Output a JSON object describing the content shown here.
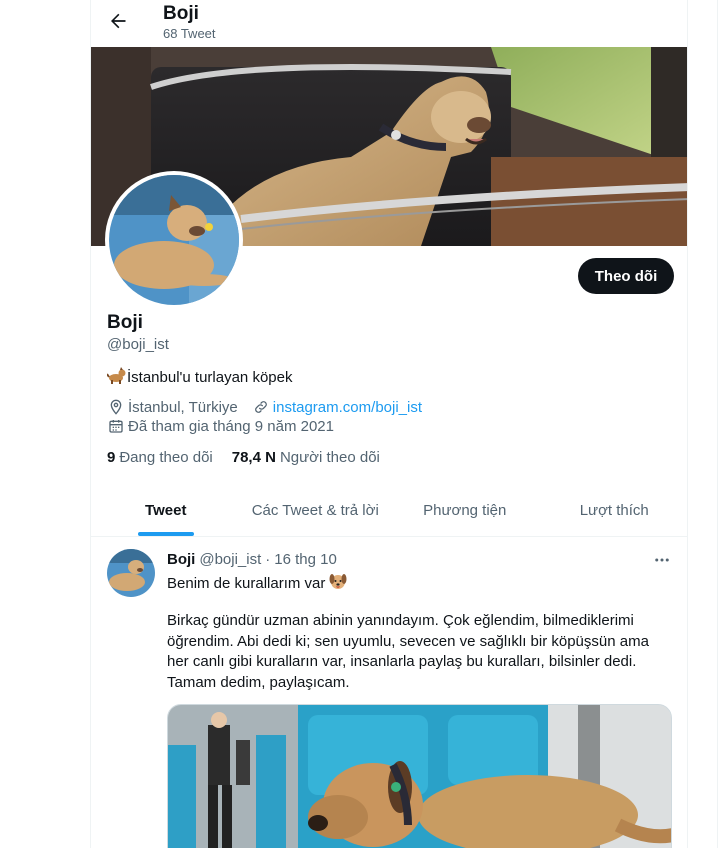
{
  "header": {
    "title": "Boji",
    "tweet_count": "68 Tweet"
  },
  "profile": {
    "name": "Boji",
    "handle": "@boji_ist",
    "bio": "İstanbul'u turlayan köpek",
    "location": "İstanbul, Türkiye",
    "website": "instagram.com/boji_ist",
    "joined": "Đã tham gia tháng 9 năm 2021",
    "following_count": "9",
    "following_label": "Đang theo dõi",
    "followers_count": "78,4 N",
    "followers_label": "Người theo dõi",
    "follow_button": "Theo dõi"
  },
  "tabs": [
    {
      "label": "Tweet",
      "active": true
    },
    {
      "label": "Các Tweet & trả lời",
      "active": false
    },
    {
      "label": "Phương tiện",
      "active": false
    },
    {
      "label": "Lượt thích",
      "active": false
    }
  ],
  "tweet": {
    "name": "Boji",
    "handle": "@boji_ist",
    "separator": "·",
    "date": "16 thg 10",
    "first_line": "Benim de kurallarım var",
    "body": "Birkaç gündür uzman abinin yanındayım. Çok eğlendim, bilmediklerimi öğrendim. Abi dedi ki; sen uyumlu, sevecen ve sağlıklı bir köpüşsün ama her canlı gibi kuralların var, insanlarla paylaş bu kuralları, bilsinler dedi. Tamam dedim, paylaşıcam."
  },
  "icons": {
    "back": "arrow-left-icon",
    "location": "location-pin-icon",
    "link": "link-icon",
    "calendar": "calendar-icon",
    "more": "more-horizontal-icon"
  },
  "colors": {
    "accent": "#1d9bf0",
    "text": "#0f1419",
    "secondary": "#536471",
    "follow_bg": "#0f1419"
  }
}
